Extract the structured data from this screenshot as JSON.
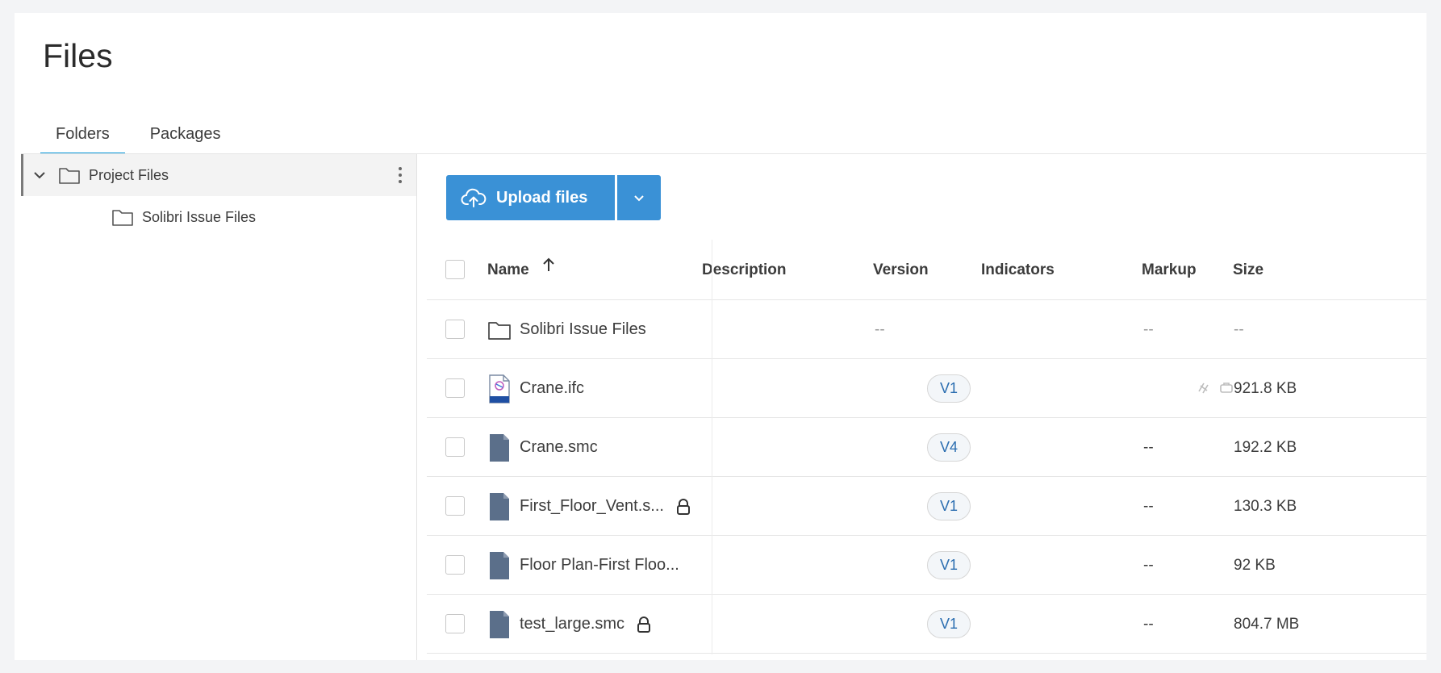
{
  "page": {
    "title": "Files"
  },
  "tabs": [
    {
      "label": "Folders",
      "active": true
    },
    {
      "label": "Packages",
      "active": false
    }
  ],
  "sidebar": {
    "tree": [
      {
        "label": "Project Files",
        "expanded": true,
        "selected": true,
        "icon": "folder-icon"
      },
      {
        "label": "Solibri Issue Files",
        "icon": "folder-icon"
      }
    ]
  },
  "toolbar": {
    "upload_label": "Upload files"
  },
  "table": {
    "columns": {
      "name": "Name",
      "description": "Description",
      "version": "Version",
      "indicators": "Indicators",
      "markup": "Markup",
      "size": "Size"
    },
    "sort": {
      "column": "Name",
      "direction": "ascending"
    },
    "rows": [
      {
        "name": "Solibri Issue Files",
        "type": "folder",
        "icon": "folder-icon",
        "version": "--",
        "markup": "--",
        "size": "--",
        "locked": false
      },
      {
        "name": "Crane.ifc",
        "type": "ifc",
        "icon": "ifc-file-icon",
        "version": "V1",
        "markup": "",
        "markup_icons": [
          "markup-link-icon",
          "markup-comment-icon"
        ],
        "size": "921.8 KB",
        "locked": false
      },
      {
        "name": "Crane.smc",
        "type": "file",
        "icon": "file-icon",
        "version": "V4",
        "markup": "--",
        "size": "192.2 KB",
        "locked": false
      },
      {
        "name": "First_Floor_Vent.s...",
        "type": "file",
        "icon": "file-icon",
        "version": "V1",
        "markup": "--",
        "size": "130.3 KB",
        "locked": true
      },
      {
        "name": "Floor Plan-First Floo...",
        "type": "file",
        "icon": "file-icon",
        "version": "V1",
        "markup": "--",
        "size": "92 KB",
        "locked": false
      },
      {
        "name": "test_large.smc",
        "type": "file",
        "icon": "file-icon",
        "version": "V1",
        "markup": "--",
        "size": "804.7 MB",
        "locked": true
      }
    ]
  },
  "colors": {
    "accent": "#0696d7",
    "button": "#3a91d6",
    "version_text": "#2a6db0",
    "file_icon": "#5b6f8a"
  }
}
